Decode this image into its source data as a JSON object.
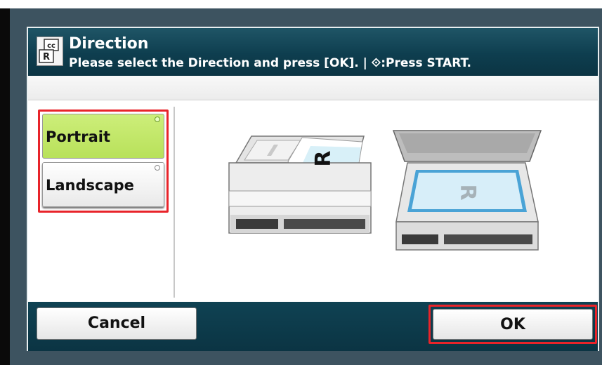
{
  "dialog": {
    "title": "Direction",
    "subtitle": "Please select the Direction and press [OK]. | ⟐:Press START.",
    "icon": "direction-icon"
  },
  "options": {
    "portrait_label": "Portrait",
    "landscape_label": "Landscape",
    "selected": "Portrait"
  },
  "illustration": {
    "adf_letter": "R",
    "glass_letter": "R"
  },
  "footer": {
    "cancel_label": "Cancel",
    "ok_label": "OK"
  },
  "colors": {
    "title_bar": "#0e3e4f",
    "selected_option": "#c4e86a",
    "focus_border": "#e8242a"
  }
}
